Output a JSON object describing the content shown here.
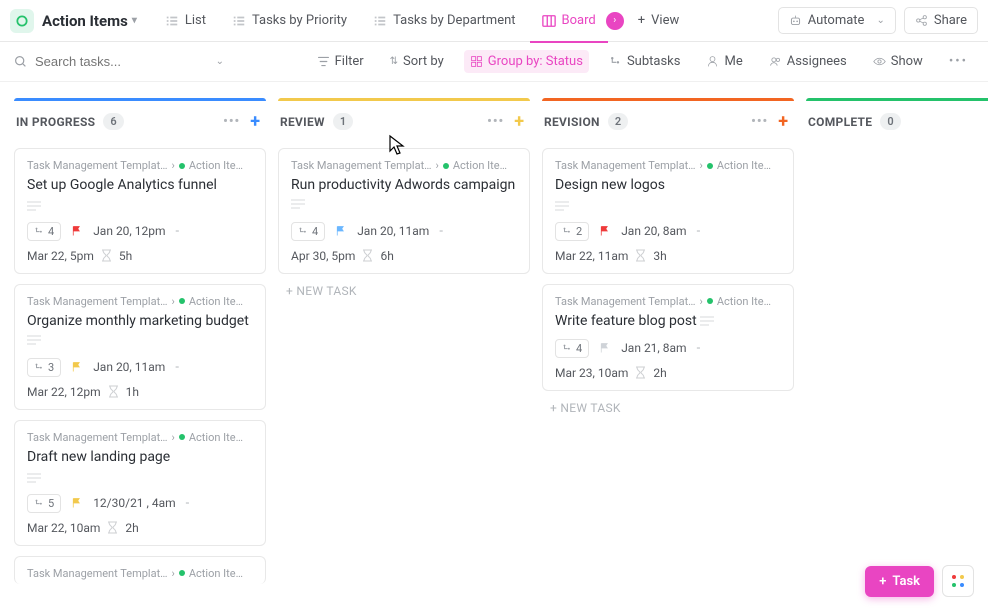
{
  "header": {
    "title": "Action Items",
    "views": [
      {
        "label": "List"
      },
      {
        "label": "Tasks by Priority"
      },
      {
        "label": "Tasks by Department"
      },
      {
        "label": "Board",
        "active": true
      },
      {
        "label": "View"
      }
    ],
    "automate": "Automate",
    "share": "Share"
  },
  "filters": {
    "search_placeholder": "Search tasks...",
    "filter": "Filter",
    "sort": "Sort by",
    "group": "Group by: Status",
    "subtasks": "Subtasks",
    "me": "Me",
    "assignees": "Assignees",
    "show": "Show"
  },
  "columns": [
    {
      "title": "IN PROGRESS",
      "count": "6",
      "color": "#3a8cff",
      "plus_color": "#3a8cff",
      "cards": [
        {
          "bc1": "Task Management Templat…",
          "bc2": "Action Ite…",
          "title": "Set up Google Analytics funnel",
          "sub": "4",
          "flag": "#ef3b3b",
          "date": "Jan 20, 12pm",
          "due": "Mar 22, 5pm",
          "est": "5h",
          "desc_after": false
        },
        {
          "bc1": "Task Management Templat…",
          "bc2": "Action Ite…",
          "title": "Organize monthly marketing budget",
          "sub": "3",
          "flag": "#f2c94c",
          "date": "Jan 20, 11am",
          "due": "Mar 22, 12pm",
          "est": "1h",
          "desc_after": true
        },
        {
          "bc1": "Task Management Templat…",
          "bc2": "Action Ite…",
          "title": "Draft new landing page",
          "sub": "5",
          "flag": "#f2c94c",
          "date": "12/30/21 , 4am",
          "due": "Mar 22, 10am",
          "est": "2h",
          "desc_after": false
        },
        {
          "bc1": "Task Management Templat…",
          "bc2": "Action Ite…",
          "title": "",
          "sub": "",
          "flag": "",
          "date": "",
          "due": "",
          "est": "",
          "partial": true
        }
      ]
    },
    {
      "title": "REVIEW",
      "count": "1",
      "color": "#f2c94c",
      "plus_color": "#f2c94c",
      "cards": [
        {
          "bc1": "Task Management Templat…",
          "bc2": "Action Ite…",
          "title": "Run productivity Adwords cam­paign",
          "sub": "4",
          "flag": "#6bb7ff",
          "date": "Jan 20, 11am",
          "due": "Apr 30, 5pm",
          "est": "6h",
          "desc_after": true
        }
      ],
      "new_task": "+ NEW TASK"
    },
    {
      "title": "REVISION",
      "count": "2",
      "color": "#f26522",
      "plus_color": "#f26522",
      "cards": [
        {
          "bc1": "Task Management Templat…",
          "bc2": "Action Ite…",
          "title": "Design new logos",
          "sub": "2",
          "flag": "#ef3b3b",
          "date": "Jan 20, 8am",
          "due": "Mar 22, 11am",
          "est": "3h",
          "desc_after": false
        },
        {
          "bc1": "Task Management Templat…",
          "bc2": "Action Ite…",
          "title": "Write feature blog post",
          "sub": "4",
          "flag": "#cfd3d8",
          "date": "Jan 21, 8am",
          "due": "Mar 23, 10am",
          "est": "2h",
          "desc_after": true
        }
      ],
      "new_task": "+ NEW TASK"
    },
    {
      "title": "COMPLETE",
      "count": "0",
      "color": "#24c26b",
      "plus_color": "#24c26b",
      "cards": []
    }
  ],
  "fab": {
    "label": "Task"
  }
}
